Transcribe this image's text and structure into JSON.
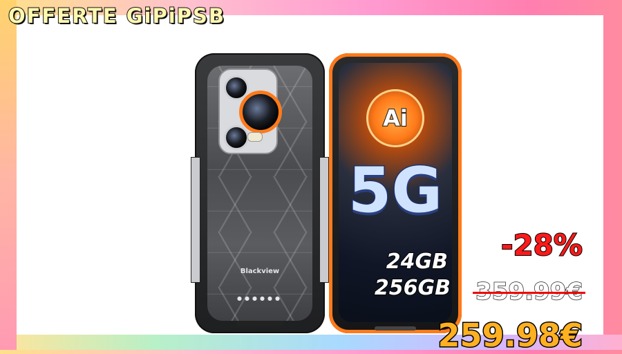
{
  "brand": {
    "title": "OFFERTE GiPiPSB"
  },
  "product": {
    "back_logo": "Blackview",
    "front_badge": "Ai",
    "network": "5G",
    "ram": "24GB",
    "storage": "256GB",
    "accent_color": "#ff7a1a"
  },
  "pricing": {
    "discount": "-28%",
    "old_price": "359.99€",
    "new_price": "259.98€"
  }
}
